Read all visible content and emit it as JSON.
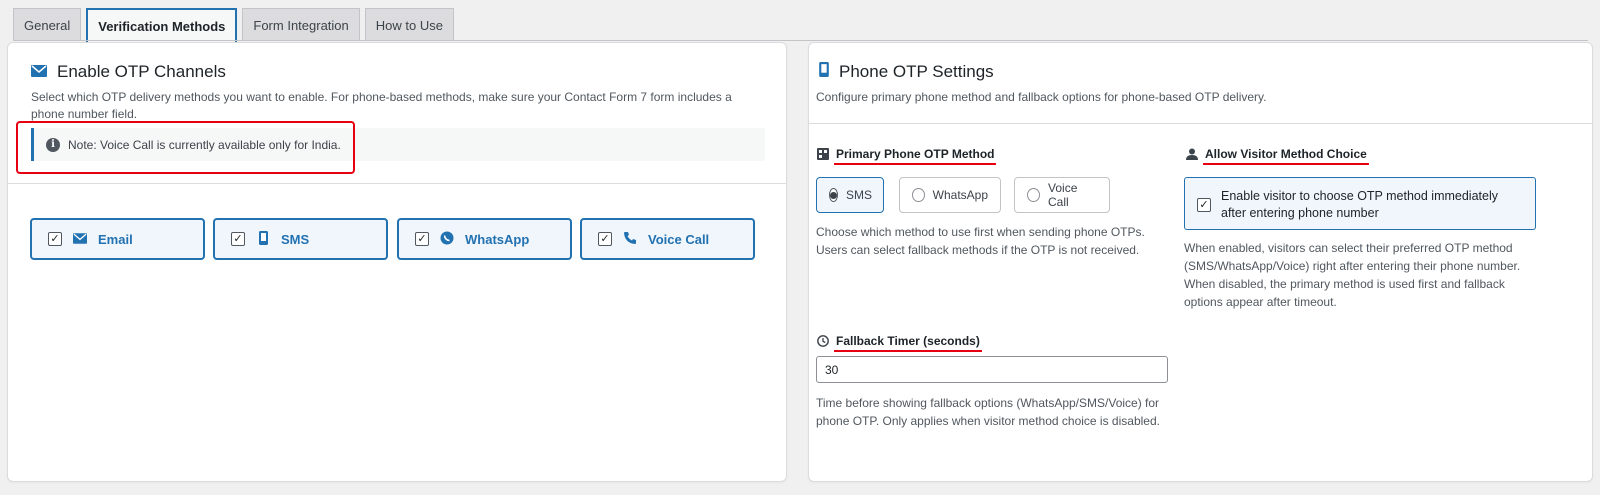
{
  "tabs": [
    {
      "label": "General"
    },
    {
      "label": "Verification Methods"
    },
    {
      "label": "Form Integration"
    },
    {
      "label": "How to Use"
    }
  ],
  "left": {
    "title": "Enable OTP Channels",
    "description": "Select which OTP delivery methods you want to enable. For phone-based methods, make sure your Contact Form 7 form includes a phone number field.",
    "note": "Note: Voice Call is currently available only for India.",
    "channels": [
      {
        "label": "Email",
        "icon": "envelope-icon",
        "checked": true
      },
      {
        "label": "SMS",
        "icon": "mobile-icon",
        "checked": true
      },
      {
        "label": "WhatsApp",
        "icon": "whatsapp-icon",
        "checked": true
      },
      {
        "label": "Voice Call",
        "icon": "phone-icon",
        "checked": true
      }
    ]
  },
  "right": {
    "title": "Phone OTP Settings",
    "description": "Configure primary phone method and fallback options for phone-based OTP delivery.",
    "primary": {
      "label": "Primary Phone OTP Method",
      "options": [
        {
          "label": "SMS",
          "selected": true
        },
        {
          "label": "WhatsApp",
          "selected": false
        },
        {
          "label": "Voice Call",
          "selected": false
        }
      ],
      "help_line1": "Choose which method to use first when sending phone OTPs.",
      "help_line2": "Users can select fallback methods if the OTP is not received."
    },
    "visitor": {
      "label": "Allow Visitor Method Choice",
      "checkbox_text": "Enable visitor to choose OTP method immediately after entering phone number",
      "help_line1": "When enabled, visitors can select their preferred OTP method",
      "help_line2": "(SMS/WhatsApp/Voice) right after entering their phone number.",
      "help_line3": "When disabled, the primary method is used first and fallback",
      "help_line4": "options appear after timeout."
    },
    "timer": {
      "label": "Fallback Timer (seconds)",
      "value": "30",
      "help_line1": "Time before showing fallback options (WhatsApp/SMS/Voice) for",
      "help_line2": "phone OTP. Only applies when visitor method choice is disabled."
    }
  },
  "colors": {
    "accent": "#2271b1",
    "highlight": "#e60012"
  }
}
